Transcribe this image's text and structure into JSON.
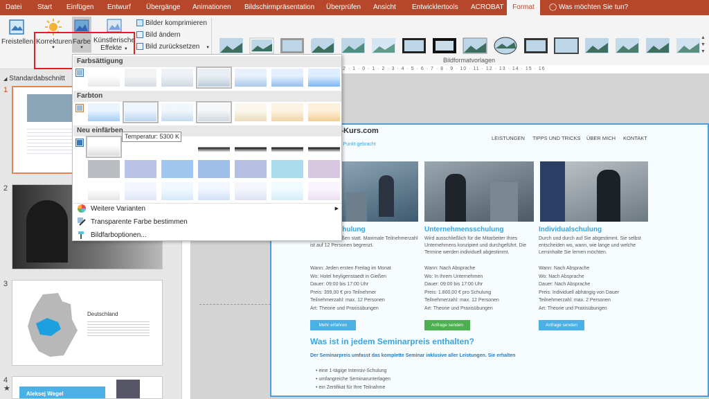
{
  "tabs": [
    {
      "label": "Datei"
    },
    {
      "label": "Start"
    },
    {
      "label": "Einfügen"
    },
    {
      "label": "Entwurf"
    },
    {
      "label": "Übergänge"
    },
    {
      "label": "Animationen"
    },
    {
      "label": "Bildschirmpräsentation"
    },
    {
      "label": "Überprüfen"
    },
    {
      "label": "Ansicht"
    },
    {
      "label": "Entwicklertools"
    },
    {
      "label": "ACROBAT"
    },
    {
      "label": "Format"
    }
  ],
  "tell_me": "Was möchten Sie tun?",
  "ribbon": {
    "freistellen": "Freistellen",
    "korrekturen": "Korrekturen",
    "farbe": "Farbe",
    "kuenstlerische_1": "Künstlerische",
    "kuenstlerische_2": "Effekte",
    "bilder_komprimieren": "Bilder komprimieren",
    "bild_aendern": "Bild ändern",
    "bild_zuruecksetzen": "Bild zurücksetzen",
    "group_label": "Bildformatvorlagen"
  },
  "colors": {
    "accent": "#b7472a",
    "slide_blue": "#38a5e2",
    "green": "#4caf50",
    "highlight": "#e02020"
  },
  "dropdown": {
    "farbsaettigung": "Farbsättigung",
    "farbton": "Farbton",
    "neu_einfaerben": "Neu einfärben",
    "tooltip": "Temperatur: 5300 K",
    "weitere_varianten": "Weitere Varianten",
    "transparente_farbe": "Transparente Farbe bestimmen",
    "bildfarboptionen": "Bildfarboptionen..."
  },
  "pane": {
    "section": "Standardabschnitt",
    "slide_numbers": [
      "1",
      "2",
      "3",
      "4"
    ],
    "slide3_title": "Deutschland",
    "slide4_label": "Aleksej Wegel"
  },
  "slide": {
    "logo": "nt-Kurs.com",
    "tagline": "den Punkt gebracht",
    "nav": [
      "LEISTUNGEN",
      "TIPPS UND TRICKS",
      "ÜBER MICH",
      "KONTAKT"
    ],
    "cards": [
      {
        "title": "Schulung",
        "text": "n Monat in Gießen statt. Maximale Teilnehmerzahl ist auf 12 Personen begrenzt.",
        "info": [
          "Wann: Jeden ersten Freitag im Monat",
          "Wo: Hotel heyligenstaedt in Gießen",
          "Dauer: 09:00 bis 17:00 Uhr",
          "Preis: 399,00 € pro Teilnehmer",
          "Teilnehmerzahl: max. 12 Personen",
          "Art: Theorie und Praxisübungen"
        ],
        "button": "Mehr erfahren"
      },
      {
        "title": "Unternehmensschulung",
        "text": "Wird ausschließlich für die Mitarbeiter Ihres Unternehmens konzipiert und durchgeführt. Die Termine werden individuell abgestimmt.",
        "info": [
          "Wann: Nach Absprache",
          "Wo: In Ihrem Unternehmen",
          "Dauer: 09:00 bis 17:00 Uhr",
          "Preis: 1.800,00 € pro Schulung",
          "Teilnehmerzahl: max. 12 Personen",
          "Art: Theorie und Praxisübungen"
        ],
        "button": "Anfrage senden"
      },
      {
        "title": "Individualschulung",
        "text": "Durch und durch auf Sie abgestimmt. Sie selbst entscheiden wo, wann, wie lange und welche Lerninhalte Sie lernen möchten.",
        "info": [
          "Wann: Nach Absprache",
          "Wo: Nach Absprache",
          "Dauer: Nach Absprache",
          "Preis: Individuell abhängig von Dauer",
          "Teilnehmerzahl: max. 2 Personen",
          "Art: Theorie und Praxisübungen"
        ],
        "button": "Anfrage senden"
      }
    ],
    "heading": "Was ist in jedem Seminarpreis enthalten?",
    "subheading": "Der Seminarpreis umfasst das komplette Seminar inklusive aller Leistungen. Sie erhalten",
    "bullets": [
      "eine 1-tägige Intensiv-Schulung",
      "umfangreiche Seminarunterlagen",
      "ein Zertifikat für Ihre Teilnahme"
    ]
  },
  "ruler_text": "2 · 1 · 0 · 1 · 2 · 3 · 4 · 5 · 6 · 7 · 8 · 9 · 10 · 11 · 12 · 13 · 14 · 15 · 16"
}
